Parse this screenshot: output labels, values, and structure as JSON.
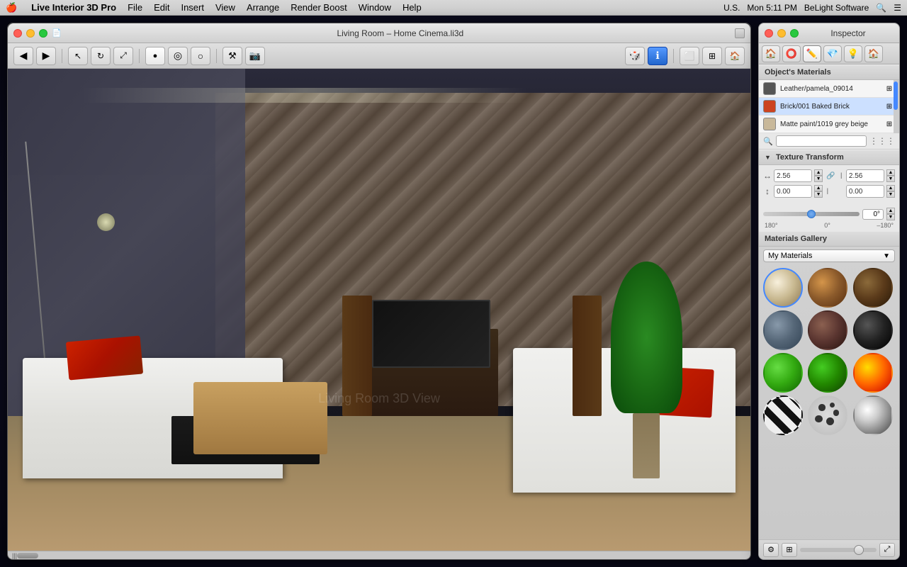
{
  "menubar": {
    "apple": "🍎",
    "app_name": "Live Interior 3D Pro",
    "menus": [
      "File",
      "Edit",
      "Insert",
      "View",
      "Arrange",
      "Render Boost",
      "Window",
      "Help"
    ],
    "time": "Mon 5:11 PM",
    "company": "BeLight Software",
    "locale": "U.S."
  },
  "window": {
    "title": "Living Room – Home Cinema.li3d"
  },
  "inspector": {
    "title": "Inspector",
    "tabs": [
      "🏠",
      "⭕",
      "✏️",
      "💎",
      "💡",
      "🏠"
    ],
    "section_materials": "Object's Materials",
    "materials": [
      {
        "id": 1,
        "name": "Leather/pamela_09014",
        "color": "#555555"
      },
      {
        "id": 2,
        "name": "Brick/001 Baked Brick",
        "color": "#cc4422"
      },
      {
        "id": 3,
        "name": "Matte paint/1019 grey beige",
        "color": "#c8b89a"
      }
    ],
    "texture_transform_label": "Texture Transform",
    "tt_h1": "2.56",
    "tt_h2": "2.56",
    "tt_v1": "0.00",
    "tt_v2": "0.00",
    "angle_value": "0°",
    "angle_min": "180°",
    "angle_mid": "0°",
    "angle_max": "–180°",
    "gallery_label": "Materials Gallery",
    "gallery_dropdown": "My Materials",
    "spheres": [
      "cream",
      "wood",
      "dark-wood",
      "stone",
      "brown",
      "black",
      "green-bright",
      "green-dark",
      "fire",
      "zebra",
      "spots",
      "metal"
    ]
  },
  "toolbar": {
    "back_label": "◀",
    "forward_label": "▶"
  }
}
